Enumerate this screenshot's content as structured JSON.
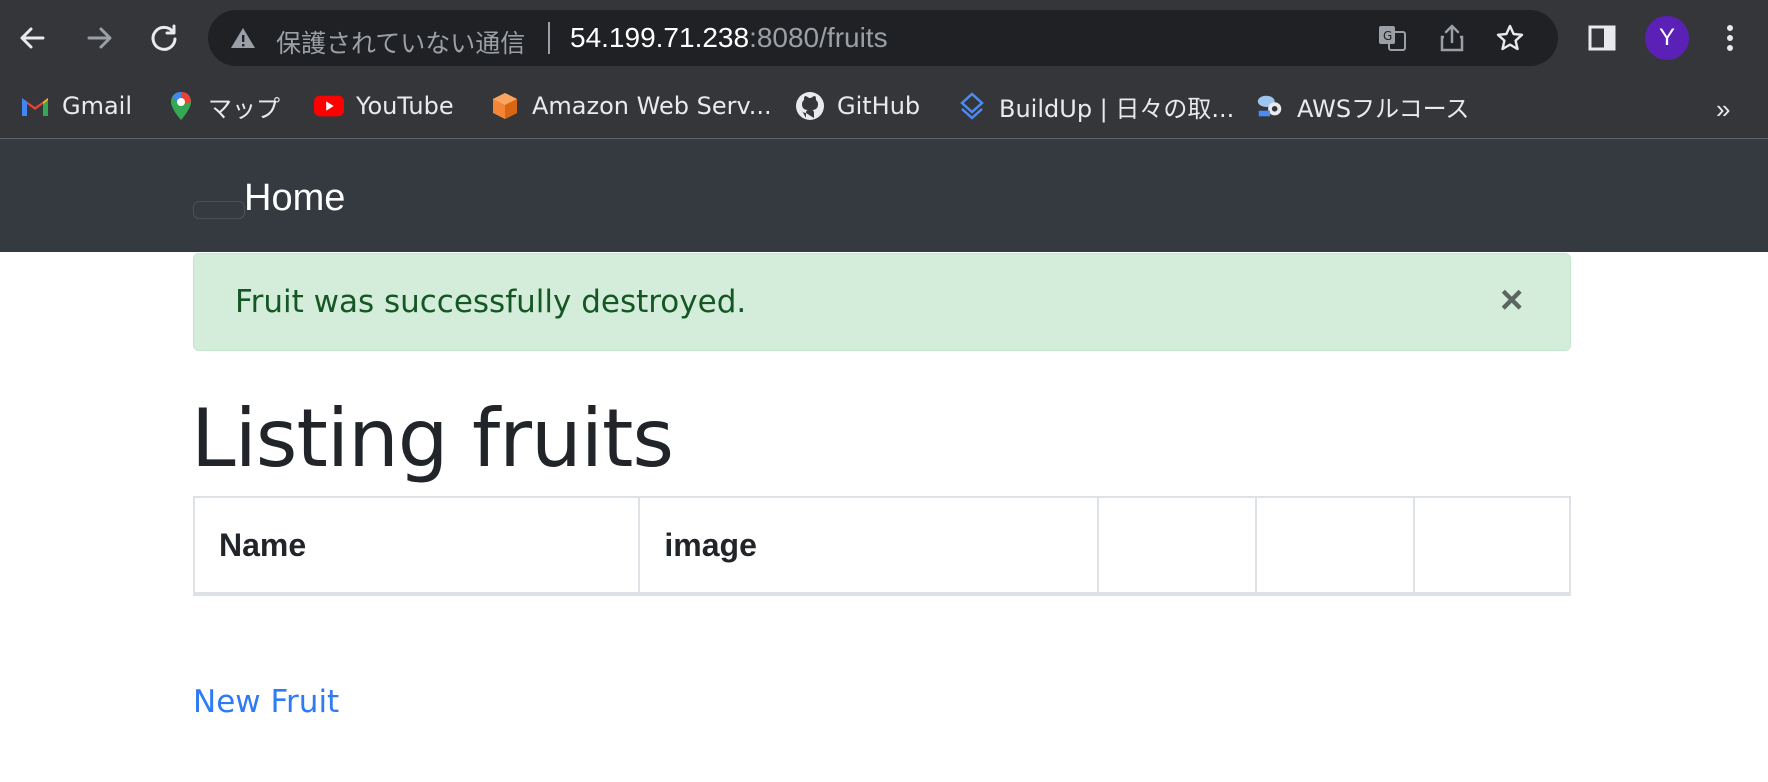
{
  "browser": {
    "security_label": "保護されていない通信",
    "url_host": "54.199.71.238",
    "url_path": ":8080/fruits",
    "avatar_letter": "Y",
    "icons": [
      "back-icon",
      "forward-icon",
      "reload-icon",
      "warning-icon",
      "translate-icon",
      "share-icon",
      "star-icon",
      "side-panel-icon",
      "kebab-menu-icon"
    ]
  },
  "bookmarks": {
    "items": [
      {
        "label": "Gmail",
        "icon": "gmail-icon"
      },
      {
        "label": "マップ",
        "icon": "maps-icon"
      },
      {
        "label": "YouTube",
        "icon": "youtube-icon"
      },
      {
        "label": "Amazon Web Serv...",
        "icon": "aws-icon"
      },
      {
        "label": "GitHub",
        "icon": "github-icon"
      },
      {
        "label": "BuildUp | 日々の取...",
        "icon": "buildup-icon"
      },
      {
        "label": "AWSフルコース",
        "icon": "aws-course-icon"
      }
    ],
    "overflow": "»"
  },
  "navbar": {
    "brand": "Home"
  },
  "alert": {
    "message": "Fruit was successfully destroyed.",
    "close": "×"
  },
  "main": {
    "title": "Listing fruits",
    "table_headers": [
      "Name",
      "image",
      "",
      "",
      ""
    ],
    "new_link": "New Fruit"
  },
  "colors": {
    "navbar_bg": "#343a40",
    "alert_bg": "#d4edda",
    "alert_text": "#155724",
    "link": "#2f7bf6"
  }
}
